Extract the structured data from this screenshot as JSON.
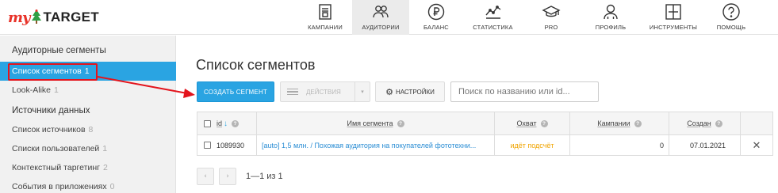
{
  "brand": {
    "my": "my",
    "target": "TARGET"
  },
  "nav": [
    {
      "icon": "campaigns-icon",
      "label": "КАМПАНИИ",
      "active": false
    },
    {
      "icon": "audiences-icon",
      "label": "АУДИТОРИИ",
      "active": true
    },
    {
      "icon": "balance-icon",
      "label": "БАЛАНС",
      "active": false
    },
    {
      "icon": "statistics-icon",
      "label": "СТАТИСТИКА",
      "active": false
    },
    {
      "icon": "pro-icon",
      "label": "PRO",
      "active": false
    },
    {
      "icon": "profile-icon",
      "label": "ПРОФИЛЬ",
      "active": false
    },
    {
      "icon": "tools-icon",
      "label": "ИНСТРУМЕНТЫ",
      "active": false
    },
    {
      "icon": "help-icon",
      "label": "ПОМОЩЬ",
      "active": false
    }
  ],
  "sidebar": {
    "section1": "Аудиторные сегменты",
    "items1": [
      {
        "label": "Список сегментов",
        "count": "1",
        "active": true
      },
      {
        "label": "Look-Alike",
        "count": "1",
        "active": false
      }
    ],
    "section2": "Источники данных",
    "items2": [
      {
        "label": "Список источников",
        "count": "8"
      },
      {
        "label": "Списки пользователей",
        "count": "1"
      },
      {
        "label": "Контекстный таргетинг",
        "count": "2"
      },
      {
        "label": "События в приложениях",
        "count": "0"
      }
    ]
  },
  "main": {
    "title": "Список сегментов",
    "create_label": "СОЗДАТЬ СЕГМЕНТ",
    "actions_label": "ДЕЙСТВИЯ",
    "settings_label": "НАСТРОЙКИ",
    "search_placeholder": "Поиск по названию или id..."
  },
  "table": {
    "columns": {
      "id": "id",
      "sort_arrow": "↓",
      "name": "Имя сегмента",
      "reach": "Охват",
      "campaigns": "Кампании",
      "created": "Создан"
    },
    "rows": [
      {
        "id": "1089930",
        "name": "[auto] 1,5 млн. / Похожая аудитория на покупателей фототехни...",
        "reach": "идёт подсчёт",
        "campaigns": "0",
        "created": "07.01.2021"
      }
    ]
  },
  "pagination": {
    "prev": "‹",
    "next": "›",
    "text": "1—1 из 1"
  },
  "colors": {
    "accent": "#2aa4e2",
    "highlight": "#e3141c",
    "reach_pending": "#f0a400",
    "brand_red": "#e8332a"
  }
}
